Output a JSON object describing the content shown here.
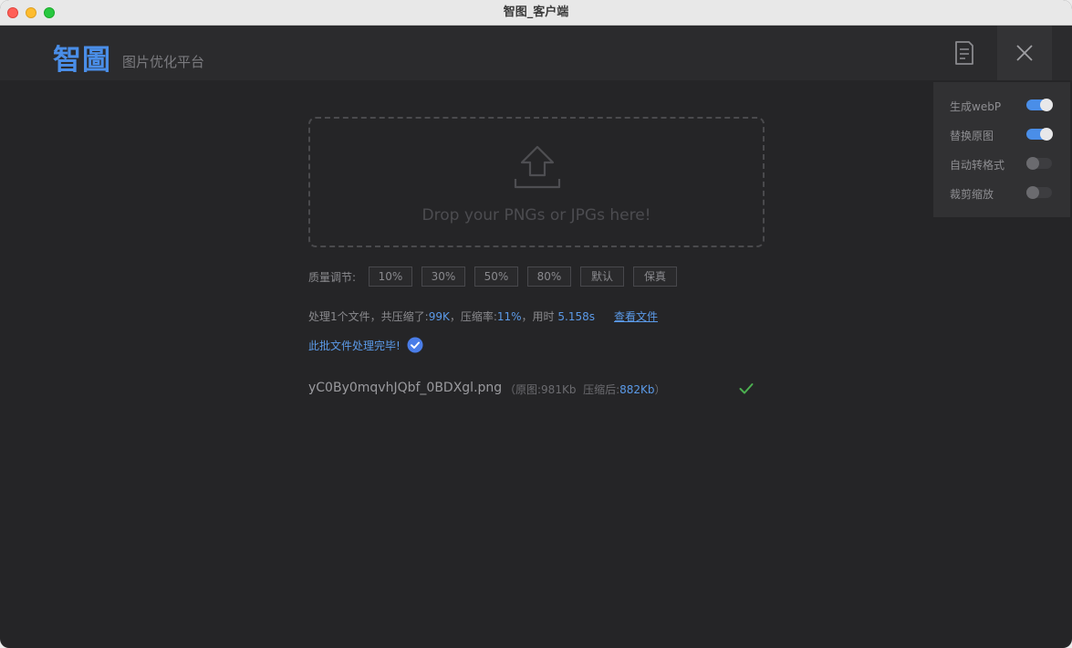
{
  "window": {
    "title": "智图_客户端"
  },
  "header": {
    "logo": "智圖",
    "subtitle": "图片优化平台",
    "doc_icon": "document-icon",
    "close_icon": "close-icon"
  },
  "settings": [
    {
      "label": "生成webP",
      "on": true
    },
    {
      "label": "替换原图",
      "on": true
    },
    {
      "label": "自动转格式",
      "on": false
    },
    {
      "label": "裁剪缩放",
      "on": false
    }
  ],
  "dropzone": {
    "icon": "upload-icon",
    "text": "Drop your PNGs or JPGs here!"
  },
  "quality": {
    "label": "质量调节:",
    "options": [
      "10%",
      "30%",
      "50%",
      "80%",
      "默认",
      "保真"
    ],
    "selected": "默认"
  },
  "result": {
    "prefix": "处理1个文件，共压缩了:",
    "saved": "99K",
    "ratio_label": "，压缩率:",
    "ratio": "11%",
    "time_label": "，用时",
    "time": "5.158s",
    "view_link": "查看文件",
    "done_text": "此批文件处理完毕!",
    "done_icon": "check-circle-icon"
  },
  "files": [
    {
      "name": "yC0By0mqvhJQbf_0BDXgl.png",
      "orig_label": "（原图:",
      "orig_size": "981Kb",
      "comp_label": "压缩后:",
      "comp_size": "882Kb",
      "close_paren": "）",
      "status_icon": "checkmark-icon"
    }
  ],
  "colors": {
    "accent": "#4a8ee8",
    "background": "#252527",
    "success": "#4caf50"
  }
}
